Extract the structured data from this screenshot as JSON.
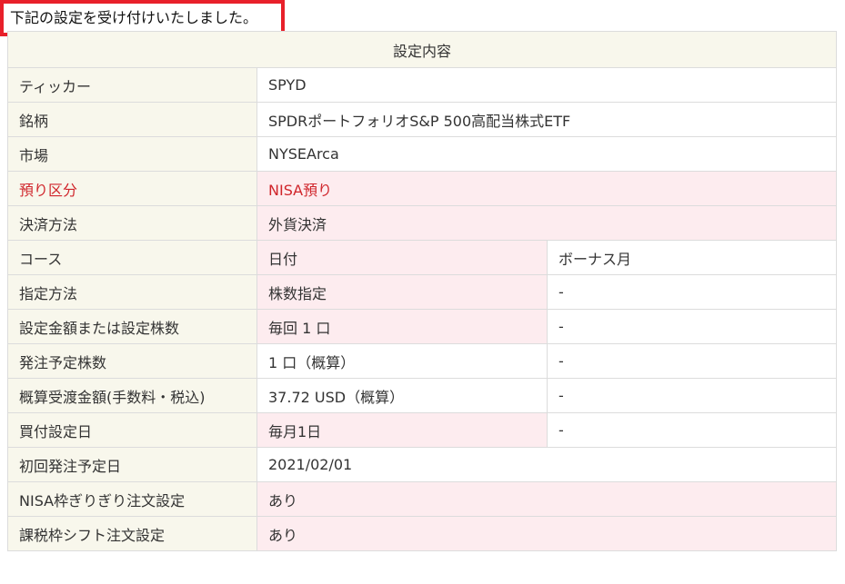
{
  "notice": "下記の設定を受け付けいたしました。",
  "table": {
    "header": "設定内容",
    "rows": [
      {
        "label": "ティッカー",
        "value": "SPYD"
      },
      {
        "label": "銘柄",
        "value": "SPDRポートフォリオS&P 500高配当株式ETF"
      },
      {
        "label": "市場",
        "value": "NYSEArca"
      },
      {
        "label": "預り区分",
        "value": "NISA預り"
      },
      {
        "label": "決済方法",
        "value": "外貨決済"
      },
      {
        "label": "コース",
        "value": "日付",
        "value2": "ボーナス月"
      },
      {
        "label": "指定方法",
        "value": "株数指定",
        "value2": "-"
      },
      {
        "label": "設定金額または設定株数",
        "value": "毎回 1 口",
        "value2": "-"
      },
      {
        "label": "発注予定株数",
        "value": "1 口（概算）",
        "value2": "-"
      },
      {
        "label": "概算受渡金額(手数料・税込)",
        "value": "37.72 USD（概算）",
        "value2": "-"
      },
      {
        "label": "買付設定日",
        "value": "毎月1日",
        "value2": "-"
      },
      {
        "label": "初回発注予定日",
        "value": "2021/02/01"
      },
      {
        "label": "NISA枠ぎりぎり注文設定",
        "value": "あり"
      },
      {
        "label": "課税枠シフト注文設定",
        "value": "あり"
      }
    ]
  },
  "colors": {
    "notice_border": "#e8202a",
    "label_bg": "#f8f7ec",
    "highlight_bg": "#fdecef",
    "alert_text": "#d0252b",
    "border": "#dcdcdc"
  }
}
